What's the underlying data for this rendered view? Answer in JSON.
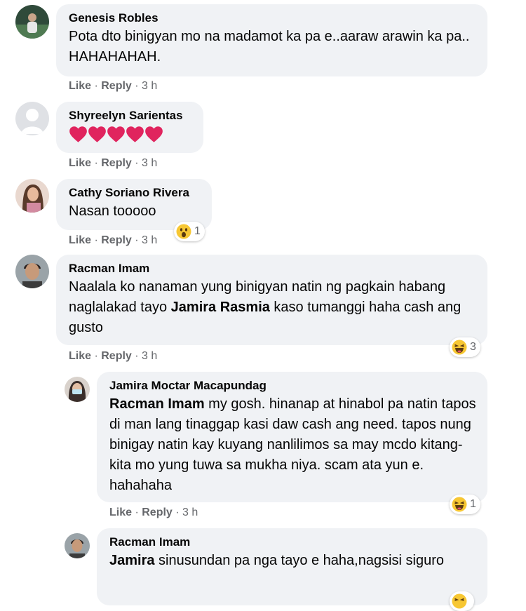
{
  "comments": [
    {
      "author": "Genesis Robles",
      "text": "Pota dto binigyan mo na madamot ka pa e..aaraw arawin ka pa.. HAHAHAHAH.",
      "like": "Like",
      "reply": "Reply",
      "time": "3 h"
    },
    {
      "author": "Shyreelyn Sarientas",
      "text": "❤️❤️❤️❤️❤️",
      "like": "Like",
      "reply": "Reply",
      "time": "3 h"
    },
    {
      "author": "Cathy Soriano Rivera",
      "text": "Nasan tooooo",
      "like": "Like",
      "reply": "Reply",
      "time": "3 h",
      "reaction_icon": "wow-emoji-icon",
      "reaction_count": "1"
    },
    {
      "author": "Racman Imam",
      "text_before": "Naalala ko nanaman yung binigyan natin ng pagkain habang naglalakad tayo ",
      "mention": "Jamira Rasmia",
      "text_after": " kaso tumanggi haha cash ang gusto",
      "like": "Like",
      "reply": "Reply",
      "time": "3 h",
      "reaction_icon": "haha-emoji-icon",
      "reaction_count": "3"
    },
    {
      "author": "Jamira Moctar Macapundag",
      "mention": "Racman Imam",
      "text_after": " my gosh. hinanap at hinabol pa natin tapos di man lang tinaggap kasi daw cash ang need. tapos nung binigay natin kay kuyang nanlilimos sa may mcdo kitang-kita mo yung tuwa sa mukha niya. scam ata yun e. hahahaha",
      "like": "Like",
      "reply": "Reply",
      "time": "3 h",
      "reaction_icon": "haha-emoji-icon",
      "reaction_count": "1"
    },
    {
      "author": "Racman Imam",
      "mention": "Jamira",
      "text_after": " sinusundan pa nga tayo e haha,nagsisi siguro"
    }
  ],
  "separator": " · ",
  "colors": {
    "bubble": "#f0f2f5",
    "secondary_text": "#65676b",
    "heart": "#e0245e",
    "emoji_yellow": "#f7c733"
  }
}
